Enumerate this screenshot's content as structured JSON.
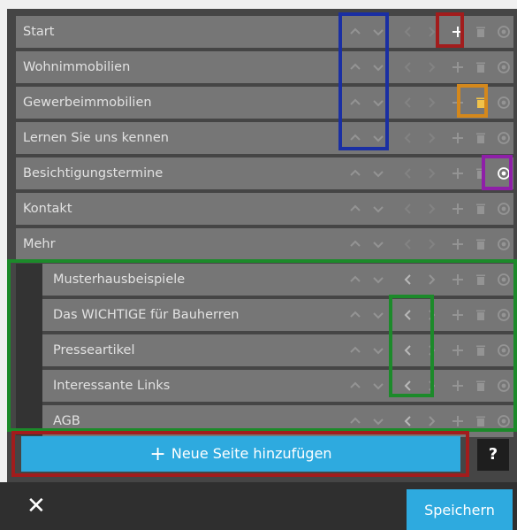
{
  "pages": [
    {
      "label": "Start",
      "level": 0
    },
    {
      "label": "Wohnimmobilien",
      "level": 0
    },
    {
      "label": "Gewerbeimmobilien",
      "level": 0
    },
    {
      "label": "Lernen Sie uns kennen",
      "level": 0
    },
    {
      "label": "Besichtigungstermine",
      "level": 0
    },
    {
      "label": "Kontakt",
      "level": 0
    },
    {
      "label": "Mehr",
      "level": 0
    },
    {
      "label": "Musterhausbeispiele",
      "level": 1
    },
    {
      "label": "Das WICHTIGE für Bauherren",
      "level": 1
    },
    {
      "label": "Presseartikel",
      "level": 1
    },
    {
      "label": "Interessante Links",
      "level": 1
    },
    {
      "label": "AGB",
      "level": 1
    }
  ],
  "row_controls": [
    "move-up",
    "move-down",
    "outdent",
    "indent",
    "add",
    "delete",
    "visibility"
  ],
  "add_page_button": {
    "label": "Neue Seite hinzufügen",
    "plus": "+"
  },
  "help_button": {
    "label": "?"
  },
  "footer": {
    "close": "✕",
    "save_label": "Speichern"
  },
  "highlight_colors": {
    "blue": "#1a2fa3",
    "red": "#a21c1c",
    "orange": "#d4881c",
    "purple": "#8f1fa8",
    "green": "#1c8a2a"
  },
  "theme": {
    "accent": "#2eaadf",
    "panel": "#454545",
    "row": "#767676"
  }
}
